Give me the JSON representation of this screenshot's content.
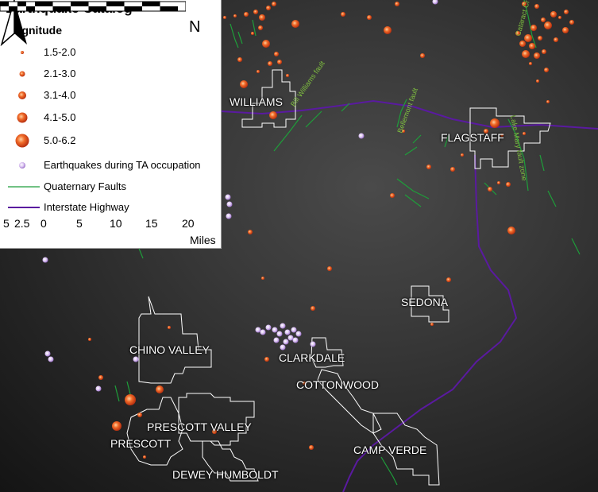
{
  "legend": {
    "title": "Earthquake Catalog",
    "subtitle": "Magnitude",
    "magnitude_classes": [
      {
        "label": "1.5-2.0",
        "size": 1
      },
      {
        "label": "2.1-3.0",
        "size": 2
      },
      {
        "label": "3.1-4.0",
        "size": 3
      },
      {
        "label": "4.1-5.0",
        "size": 4
      },
      {
        "label": "5.0-6.2",
        "size": 5
      }
    ],
    "ta_label": "Earthquakes during TA occupation",
    "faults_label": "Quaternary Faults",
    "highway_label": "Interstate Highway"
  },
  "north_arrow": {
    "label": "N"
  },
  "scale_bar": {
    "ticks": [
      "5",
      "2.5",
      "0",
      "5",
      "10",
      "15",
      "20"
    ],
    "units": "Miles"
  },
  "cities": {
    "williams": "WILLIAMS",
    "flagstaff": "FLAGSTAFF",
    "sedona": "SEDONA",
    "chino_valley": "CHINO VALLEY",
    "clarkdale": "CLARKDALE",
    "cottonwood": "COTTONWOOD",
    "prescott_valley": "PRESCOTT VALLEY",
    "prescott": "PRESCOTT",
    "camp_verde": "CAMP VERDE",
    "dewey_humboldt": "DEWEY HUMBOLDT"
  },
  "fault_labels": {
    "bill_williams": "Bill Williams fault",
    "bellemont": "Bellemont fault",
    "lake_mary": "Lake Mary fault zone",
    "cataract": "Cataract Cr fault"
  },
  "colors": {
    "quake_fill": "#e8541a",
    "quake_glow": "#ffb27a",
    "ta_fill": "#c8a6e8",
    "fault": "#1e9e3a",
    "highway": "#5a1aa0",
    "city_boundary": "#ffffff"
  }
}
